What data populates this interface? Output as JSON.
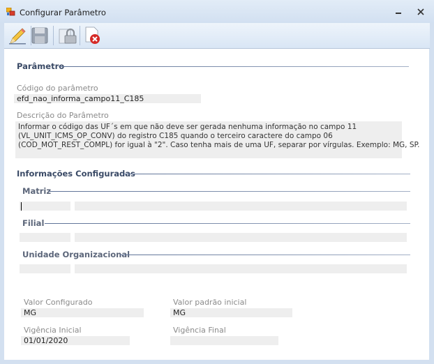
{
  "window": {
    "title": "Configurar Parâmetro",
    "icon": "app-window-icon",
    "controls": [
      "minimize-icon",
      "close-icon"
    ]
  },
  "toolbar": {
    "buttons": [
      {
        "name": "edit-button",
        "icon": "pencil-icon"
      },
      {
        "name": "save-button",
        "icon": "floppy-disk-icon"
      },
      {
        "name": "lock-button",
        "icon": "padlock-icon"
      },
      {
        "name": "delete-button",
        "icon": "document-red-x-icon"
      }
    ]
  },
  "parametro": {
    "section_title": "Parâmetro",
    "codigo_label": "Código do parâmetro",
    "codigo_value": "efd_nao_informa_campo11_C185",
    "descricao_label": "Descrição do Parâmetro",
    "descricao_lines": [
      "Informar o código das UF´s em que não deve ser gerada nenhuma informação no campo 11",
      "(VL_UNIT_ICMS_OP_CONV) do registro C185 quando o terceiro caractere do campo 06",
      "(COD_MOT_REST_COMPL) for igual à \"2\". Caso tenha mais de uma UF, separar por vírgulas. Exemplo: MG, SP."
    ]
  },
  "informacoes": {
    "section_title": "Informações Configuradas",
    "matriz": {
      "title": "Matriz",
      "code": "",
      "description": ""
    },
    "filial": {
      "title": "Filial",
      "code": "",
      "description": ""
    },
    "unidade": {
      "title": "Unidade Organizacional",
      "code": "",
      "description": ""
    }
  },
  "valores": {
    "valor_configurado_label": "Valor Configurado",
    "valor_configurado": "MG",
    "valor_padrao_label": "Valor padrão inicial",
    "valor_padrao": "MG",
    "vigencia_inicial_label": "Vigência Inicial",
    "vigencia_inicial": "01/01/2020",
    "vigencia_final_label": "Vigência Final",
    "vigencia_final": ""
  },
  "colors": {
    "chrome": "#d3e0f0",
    "section_text": "#3a4a66",
    "field_bg": "#eeeeee",
    "label_text": "#8a8a8a"
  }
}
